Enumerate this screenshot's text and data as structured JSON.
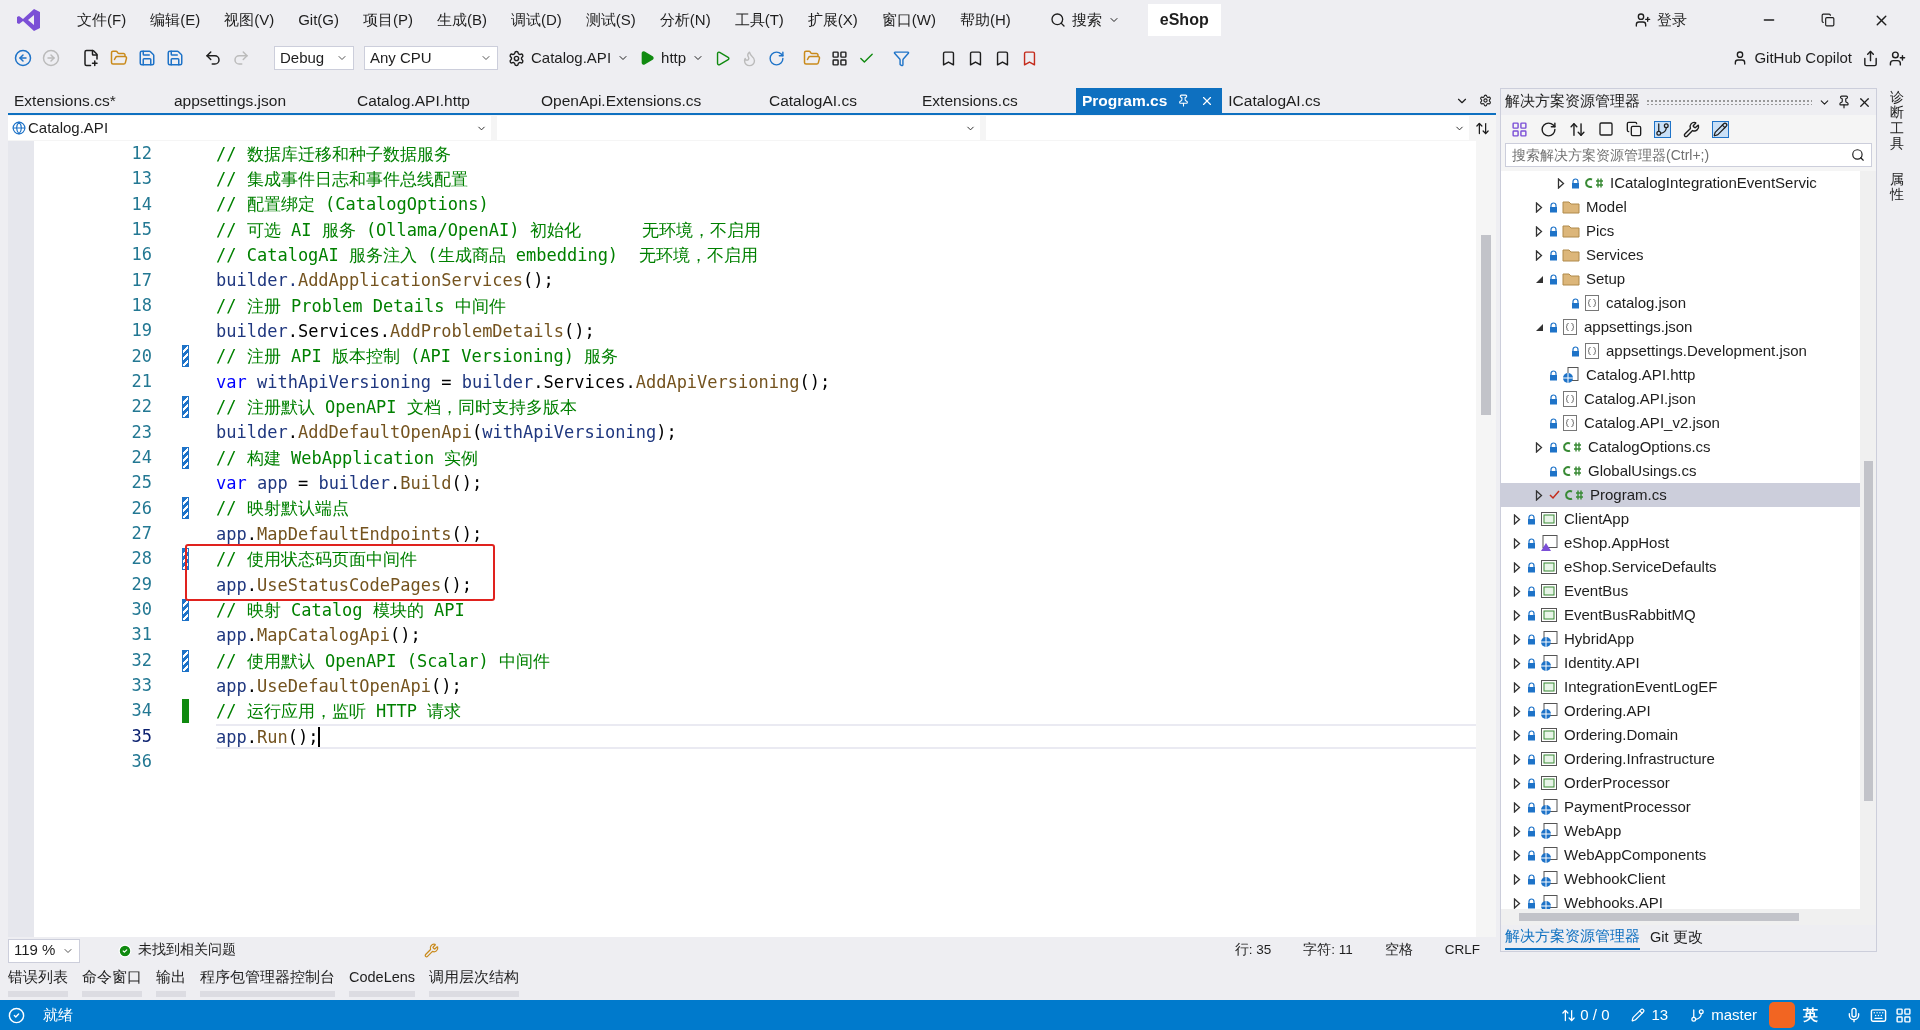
{
  "window": {
    "title": "eShop",
    "search": "搜索",
    "sign_in": "登录",
    "copilot": "GitHub Copilot"
  },
  "menu": [
    "文件(F)",
    "编辑(E)",
    "视图(V)",
    "Git(G)",
    "项目(P)",
    "生成(B)",
    "调试(D)",
    "测试(S)",
    "分析(N)",
    "工具(T)",
    "扩展(X)",
    "窗口(W)",
    "帮助(H)"
  ],
  "toolbar": {
    "configuration": "Debug",
    "platform": "Any CPU",
    "startup": "Catalog.API",
    "profile": "http"
  },
  "tabs": [
    {
      "label": "Extensions.cs*",
      "selected": false
    },
    {
      "label": "appsettings.json",
      "selected": false
    },
    {
      "label": "Catalog.API.http",
      "selected": false
    },
    {
      "label": "OpenApi.Extensions.cs",
      "selected": false
    },
    {
      "label": "CatalogAI.cs",
      "selected": false
    },
    {
      "label": "Extensions.cs",
      "selected": false
    },
    {
      "label": "Program.cs",
      "selected": true
    },
    {
      "label": "ICatalogAI.cs",
      "selected": false
    }
  ],
  "nav": {
    "project": "Catalog.API"
  },
  "code": [
    {
      "number": "12",
      "tokens": [
        {
          "kind": "comment",
          "text": "// 数据库迁移和种子数据服务"
        }
      ]
    },
    {
      "number": "13",
      "tokens": [
        {
          "kind": "comment",
          "text": "// 集成事件日志和事件总线配置"
        }
      ]
    },
    {
      "number": "14",
      "tokens": [
        {
          "kind": "comment",
          "text": "// 配置绑定 (CatalogOptions)"
        }
      ]
    },
    {
      "number": "15",
      "tokens": [
        {
          "kind": "comment",
          "text": "// 可选 AI 服务 (Ollama/OpenAI) 初始化      无环境，不启用"
        }
      ]
    },
    {
      "number": "16",
      "tokens": [
        {
          "kind": "comment",
          "text": "// CatalogAI 服务注入 (生成商品 embedding)  无环境，不启用"
        }
      ]
    },
    {
      "number": "17",
      "tokens": [
        {
          "kind": "local",
          "text": "builder."
        },
        {
          "kind": "method",
          "text": "AddApplicationServices"
        },
        {
          "kind": "plain",
          "text": "();"
        }
      ]
    },
    {
      "number": "18",
      "tokens": [
        {
          "kind": "comment",
          "text": "// 注册 Problem Details 中间件"
        }
      ]
    },
    {
      "number": "19",
      "tokens": [
        {
          "kind": "local",
          "text": "builder"
        },
        {
          "kind": "plain",
          "text": ".Services."
        },
        {
          "kind": "method",
          "text": "AddProblemDetails"
        },
        {
          "kind": "plain",
          "text": "();"
        }
      ]
    },
    {
      "number": "20",
      "modified": true,
      "saved": true,
      "tokens": [
        {
          "kind": "comment",
          "text": "// 注册 API 版本控制 (API Versioning) 服务"
        }
      ]
    },
    {
      "number": "21",
      "tokens": [
        {
          "kind": "keyword",
          "text": "var"
        },
        {
          "kind": "local",
          "text": " withApiVersioning"
        },
        {
          "kind": "plain",
          "text": " = "
        },
        {
          "kind": "local",
          "text": "builder"
        },
        {
          "kind": "plain",
          "text": ".Services."
        },
        {
          "kind": "method",
          "text": "AddApiVersioning"
        },
        {
          "kind": "plain",
          "text": "();"
        }
      ]
    },
    {
      "number": "22",
      "modified": true,
      "saved": true,
      "tokens": [
        {
          "kind": "comment",
          "text": "// 注册默认 OpenAPI 文档，同时支持多版本"
        }
      ]
    },
    {
      "number": "23",
      "tokens": [
        {
          "kind": "local",
          "text": "builder"
        },
        {
          "kind": "plain",
          "text": "."
        },
        {
          "kind": "method",
          "text": "AddDefaultOpenApi"
        },
        {
          "kind": "plain",
          "text": "("
        },
        {
          "kind": "local",
          "text": "withApiVersioning"
        },
        {
          "kind": "plain",
          "text": ");"
        }
      ]
    },
    {
      "number": "24",
      "modified": true,
      "saved": true,
      "tokens": [
        {
          "kind": "comment",
          "text": "// 构建 WebApplication 实例"
        }
      ]
    },
    {
      "number": "25",
      "tokens": [
        {
          "kind": "keyword",
          "text": "var"
        },
        {
          "kind": "local",
          "text": " app"
        },
        {
          "kind": "plain",
          "text": " = "
        },
        {
          "kind": "local",
          "text": "builder"
        },
        {
          "kind": "plain",
          "text": "."
        },
        {
          "kind": "method",
          "text": "Build"
        },
        {
          "kind": "plain",
          "text": "();"
        }
      ]
    },
    {
      "number": "26",
      "modified": true,
      "saved": true,
      "tokens": [
        {
          "kind": "comment",
          "text": "// 映射默认端点"
        }
      ]
    },
    {
      "number": "27",
      "tokens": [
        {
          "kind": "local",
          "text": "app"
        },
        {
          "kind": "plain",
          "text": "."
        },
        {
          "kind": "method",
          "text": "MapDefaultEndpoints"
        },
        {
          "kind": "plain",
          "text": "();"
        }
      ]
    },
    {
      "number": "28",
      "modified": true,
      "saved": true,
      "boxed": true,
      "tokens": [
        {
          "kind": "comment",
          "text": "// 使用状态码页面中间件"
        }
      ]
    },
    {
      "number": "29",
      "boxed": true,
      "tokens": [
        {
          "kind": "local",
          "text": "app"
        },
        {
          "kind": "plain",
          "text": "."
        },
        {
          "kind": "method",
          "text": "UseStatusCodePages"
        },
        {
          "kind": "plain",
          "text": "();"
        }
      ]
    },
    {
      "number": "30",
      "modified": true,
      "saved": true,
      "tokens": [
        {
          "kind": "comment",
          "text": "// 映射 Catalog 模块的 API"
        }
      ]
    },
    {
      "number": "31",
      "tokens": [
        {
          "kind": "local",
          "text": "app"
        },
        {
          "kind": "plain",
          "text": "."
        },
        {
          "kind": "method",
          "text": "MapCatalogApi"
        },
        {
          "kind": "plain",
          "text": "();"
        }
      ]
    },
    {
      "number": "32",
      "modified": true,
      "saved": true,
      "tokens": [
        {
          "kind": "comment",
          "text": "// 使用默认 OpenAPI (Scalar) 中间件"
        }
      ]
    },
    {
      "number": "33",
      "tokens": [
        {
          "kind": "local",
          "text": "app"
        },
        {
          "kind": "plain",
          "text": "."
        },
        {
          "kind": "method",
          "text": "UseDefaultOpenApi"
        },
        {
          "kind": "plain",
          "text": "();"
        }
      ]
    },
    {
      "number": "34",
      "modified": true,
      "saved": false,
      "tokens": [
        {
          "kind": "comment",
          "text": "// 运行应用，监听 HTTP 请求"
        }
      ]
    },
    {
      "number": "35",
      "current": true,
      "tokens": [
        {
          "kind": "local",
          "text": "app"
        },
        {
          "kind": "plain",
          "text": "."
        },
        {
          "kind": "method",
          "text": "Run"
        },
        {
          "kind": "plain",
          "text": "();"
        }
      ]
    },
    {
      "number": "36"
    }
  ],
  "editor_status": {
    "zoom": "119 %",
    "issues": "未找到相关问题",
    "line": "行: 35",
    "char": "字符: 11",
    "whitespace": "空格",
    "line_ending": "CRLF"
  },
  "bottom_tabs": [
    "错误列表",
    "命令窗口",
    "输出",
    "程序包管理器控制台",
    "CodeLens",
    "调用层次结构"
  ],
  "solution_explorer": {
    "title": "解决方案资源管理器",
    "search": {
      "placeholder": "搜索解决方案资源管理器(Ctrl+;)"
    },
    "tree": [
      {
        "children": [
          {
            "children": [
              {
                "label": "ICatalogIntegrationEventServic",
                "kind": "cs",
                "locked": true,
                "expanded": false
              }
            ]
          },
          {
            "label": "Model",
            "kind": "folder",
            "locked": true,
            "expanded": false
          },
          {
            "label": "Pics",
            "kind": "folder",
            "locked": true,
            "expanded": false
          },
          {
            "label": "Services",
            "kind": "folder",
            "locked": true,
            "expanded": false
          },
          {
            "label": "Setup",
            "kind": "folder",
            "locked": true,
            "expanded": true,
            "children": [
              {
                "label": "catalog.json",
                "kind": "json",
                "locked": true
              }
            ]
          },
          {
            "label": "appsettings.json",
            "kind": "json",
            "locked": true,
            "expanded": true,
            "children": [
              {
                "label": "appsettings.Development.json",
                "kind": "json",
                "locked": true
              }
            ]
          },
          {
            "label": "Catalog.API.http",
            "kind": "http",
            "locked": true
          },
          {
            "label": "Catalog.API.json",
            "kind": "json",
            "locked": true
          },
          {
            "label": "Catalog.API_v2.json",
            "kind": "json",
            "locked": true
          },
          {
            "label": "CatalogOptions.cs",
            "kind": "cs",
            "locked": true,
            "expanded": false
          },
          {
            "label": "GlobalUsings.cs",
            "kind": "cs",
            "locked": true
          },
          {
            "label": "Program.cs",
            "kind": "cs",
            "locked": false,
            "expanded": false,
            "selected": true
          }
        ]
      },
      {
        "label": "ClientApp",
        "kind": "project",
        "locked": true,
        "expanded": false
      },
      {
        "label": "eShop.AppHost",
        "kind": "apphost",
        "locked": true,
        "expanded": false
      },
      {
        "label": "eShop.ServiceDefaults",
        "kind": "project",
        "locked": true,
        "expanded": false
      },
      {
        "label": "EventBus",
        "kind": "project",
        "locked": true,
        "expanded": false
      },
      {
        "label": "EventBusRabbitMQ",
        "kind": "project",
        "locked": true,
        "expanded": false
      },
      {
        "label": "HybridApp",
        "kind": "web",
        "locked": true,
        "expanded": false
      },
      {
        "label": "Identity.API",
        "kind": "web",
        "locked": true,
        "expanded": false
      },
      {
        "label": "IntegrationEventLogEF",
        "kind": "project",
        "locked": true,
        "expanded": false
      },
      {
        "label": "Ordering.API",
        "kind": "web",
        "locked": true,
        "expanded": false
      },
      {
        "label": "Ordering.Domain",
        "kind": "project",
        "locked": true,
        "expanded": false
      },
      {
        "label": "Ordering.Infrastructure",
        "kind": "project",
        "locked": true,
        "expanded": false
      },
      {
        "label": "OrderProcessor",
        "kind": "project",
        "locked": true,
        "expanded": false
      },
      {
        "label": "PaymentProcessor",
        "kind": "web",
        "locked": true,
        "expanded": false
      },
      {
        "label": "WebApp",
        "kind": "web",
        "locked": true,
        "expanded": false
      },
      {
        "label": "WebAppComponents",
        "kind": "web",
        "locked": true,
        "expanded": false
      },
      {
        "label": "WebhookClient",
        "kind": "web",
        "locked": true,
        "expanded": false
      },
      {
        "label": "Webhooks.API",
        "kind": "web",
        "locked": true,
        "expanded": false
      }
    ],
    "tabs": [
      {
        "label": "解决方案资源管理器",
        "selected": true
      },
      {
        "label": "Git 更改",
        "selected": false
      }
    ]
  },
  "side_strip": [
    "诊断工具",
    "属性"
  ],
  "status_bar": {
    "state": "就绪",
    "changes": "0 / 0",
    "edits": "13",
    "branch": "master",
    "ime": "英"
  }
}
